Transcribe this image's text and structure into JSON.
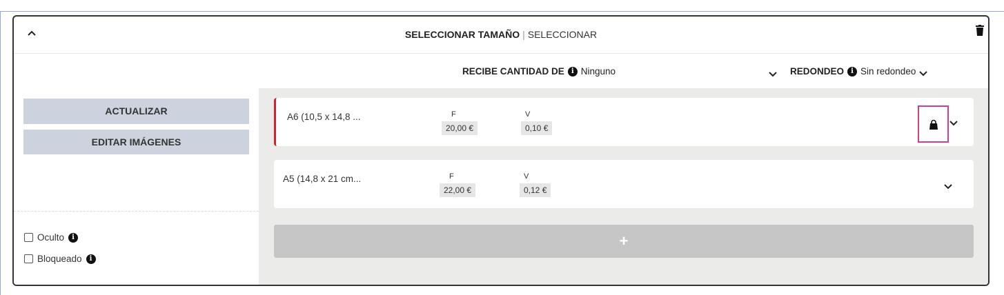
{
  "header": {
    "title_bold": "SELECCIONAR TAMAÑO",
    "separator": "|",
    "title_link": "SELECCIONAR"
  },
  "subheader": {
    "recibe_label": "RECIBE CANTIDAD DE",
    "recibe_value": "Ninguno",
    "redondeo_label": "REDONDEO",
    "redondeo_value": "Sin redondeo"
  },
  "sidebar": {
    "update_label": "ACTUALIZAR",
    "edit_images_label": "EDITAR IMÁGENES",
    "hidden_label": "Oculto",
    "locked_label": "Bloqueado"
  },
  "sizes": [
    {
      "name": "A6 (10,5 x 14,8 ...",
      "f_label": "F",
      "f_value": "20,00 €",
      "v_label": "V",
      "v_value": "0,10 €"
    },
    {
      "name": "A5 (14,8 x 21 cm...",
      "f_label": "F",
      "f_value": "22,00 €",
      "v_label": "V",
      "v_value": "0,12 €"
    }
  ],
  "add_label": "+",
  "icons": {
    "info": "i"
  },
  "colors": {
    "active_border": "#d6202f",
    "lock_highlight": "#d33c8a",
    "button_bg": "#ccd3de"
  }
}
